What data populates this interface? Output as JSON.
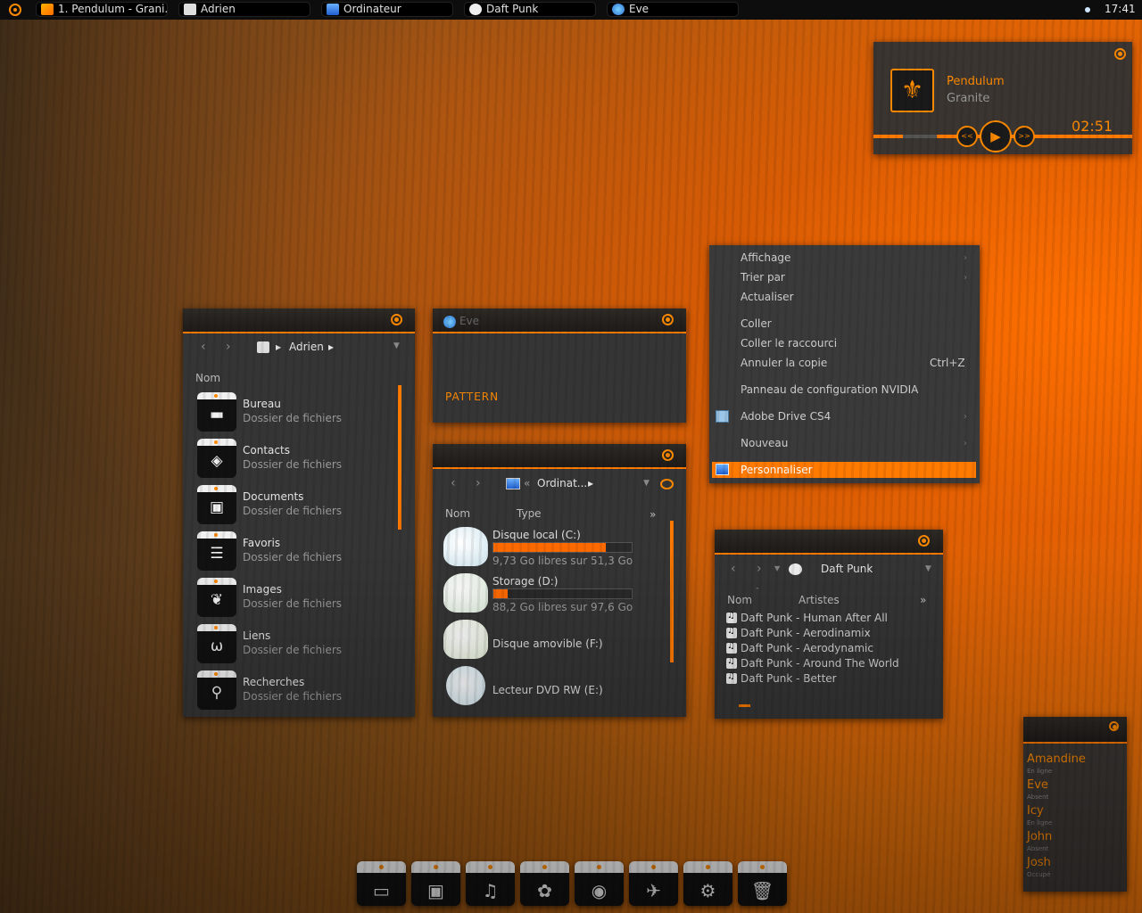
{
  "taskbar": {
    "tasks": [
      {
        "label": "1. Pendulum - Grani...",
        "icon": "music-icon"
      },
      {
        "label": "Adrien",
        "icon": "user-folder-icon"
      },
      {
        "label": "Ordinateur",
        "icon": "computer-icon"
      },
      {
        "label": "Daft Punk",
        "icon": "music-folder-icon"
      },
      {
        "label": "Eve",
        "icon": "contact-icon"
      }
    ],
    "clock": "17:41"
  },
  "player": {
    "artist": "Pendulum",
    "album": "Granite",
    "time": "02:51",
    "prev_label": "<<",
    "next_label": ">>",
    "play_label": "▶",
    "cover_glyph": "⚜"
  },
  "adrien_window": {
    "breadcrumb": "Adrien",
    "column_header": "Nom",
    "items": [
      {
        "name": "Bureau",
        "type": "Dossier de fichiers",
        "glyph": "▬",
        "icon": "desktop-icon"
      },
      {
        "name": "Contacts",
        "type": "Dossier de fichiers",
        "glyph": "◈",
        "icon": "contacts-icon"
      },
      {
        "name": "Documents",
        "type": "Dossier de fichiers",
        "glyph": "▣",
        "icon": "documents-icon"
      },
      {
        "name": "Favoris",
        "type": "Dossier de fichiers",
        "glyph": "☰",
        "icon": "favorites-icon"
      },
      {
        "name": "Images",
        "type": "Dossier de fichiers",
        "glyph": "❦",
        "icon": "images-icon"
      },
      {
        "name": "Liens",
        "type": "Dossier de fichiers",
        "glyph": "ω",
        "icon": "links-icon"
      },
      {
        "name": "Recherches",
        "type": "Dossier de fichiers",
        "glyph": "⚲",
        "icon": "search-icon"
      }
    ]
  },
  "eve_window": {
    "title": "Eve",
    "pattern_label": "PATTERN"
  },
  "computer_window": {
    "breadcrumb": "Ordinat...",
    "breadcrumb_sep": "«",
    "columns": [
      "Nom",
      "Type"
    ],
    "more": "»",
    "drives": [
      {
        "name": "Disque local (C:)",
        "free": "9,73 Go libres sur 51,3 Go",
        "used_fraction": 0.81
      },
      {
        "name": "Storage (D:)",
        "free": "88,2 Go libres sur 97,6 Go",
        "used_fraction": 0.1
      },
      {
        "name": "Disque amovible (F:)",
        "free": "",
        "used_fraction": null
      },
      {
        "name": "Lecteur DVD RW (E:)",
        "free": "",
        "used_fraction": null
      }
    ]
  },
  "context_menu": {
    "items": [
      {
        "label": "Affichage",
        "submenu": true
      },
      {
        "label": "Trier par",
        "submenu": true
      },
      {
        "label": "Actualiser",
        "submenu": false
      },
      {
        "label": "Coller",
        "submenu": false
      },
      {
        "label": "Coller le raccourci",
        "submenu": false
      },
      {
        "label": "Annuler la copie",
        "shortcut": "Ctrl+Z",
        "submenu": false
      },
      {
        "label": "Panneau de configuration NVIDIA",
        "submenu": false
      },
      {
        "label": "Adobe Drive CS4",
        "submenu": true
      },
      {
        "label": "Nouveau",
        "submenu": true
      },
      {
        "label": "Personnaliser",
        "submenu": false,
        "selected": true
      }
    ]
  },
  "music_window": {
    "breadcrumb": "Daft Punk",
    "columns": [
      "Nom",
      "Artistes"
    ],
    "more": "»",
    "tracks": [
      "Daft Punk -  Human After All",
      "Daft Punk - Aerodinamix",
      "Daft Punk - Aerodynamic",
      "Daft Punk - Around The World",
      "Daft Punk - Better"
    ]
  },
  "contacts": [
    {
      "name": "Amandine",
      "status": "En ligne"
    },
    {
      "name": "Eve",
      "status": "Absent"
    },
    {
      "name": "Icy",
      "status": "En ligne"
    },
    {
      "name": "John",
      "status": "Absent"
    },
    {
      "name": "Josh",
      "status": "Occupé"
    }
  ],
  "dock": [
    {
      "icon": "computer-icon",
      "glyph": "▭"
    },
    {
      "icon": "briefcase-icon",
      "glyph": "▣"
    },
    {
      "icon": "music-icon",
      "glyph": "♫"
    },
    {
      "icon": "flower-icon",
      "glyph": "✿"
    },
    {
      "icon": "firefox-icon",
      "glyph": "◉"
    },
    {
      "icon": "network-icon",
      "glyph": "✈"
    },
    {
      "icon": "settings-icon",
      "glyph": "⚙"
    },
    {
      "icon": "trash-icon",
      "glyph": "🗑"
    }
  ],
  "colors": {
    "accent": "#ff7a00",
    "window_bg": "#353535",
    "taskbar_bg": "#0d0d0d"
  }
}
